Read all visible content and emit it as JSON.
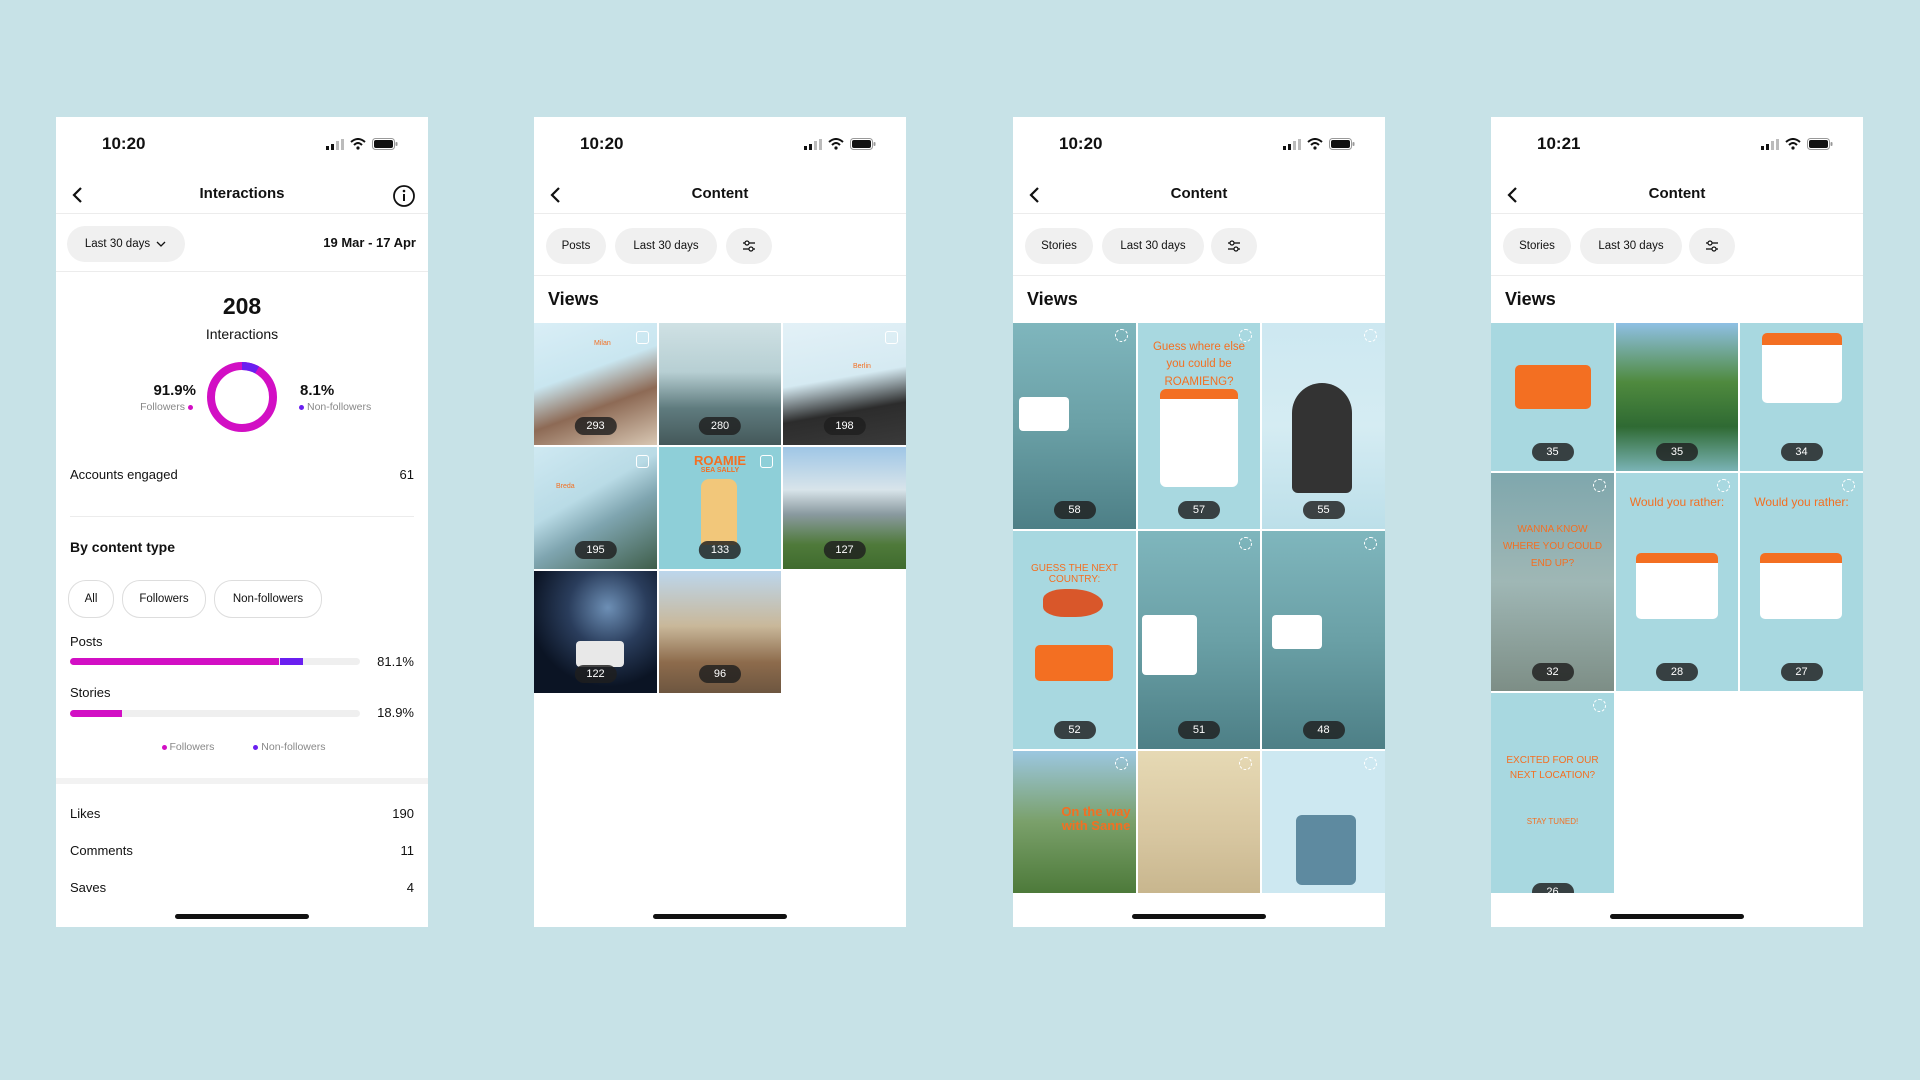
{
  "colors": {
    "magenta": "#d20fc4",
    "purple": "#6a1ff0",
    "teal": "#8ecfd8",
    "background": "#c7e2e7"
  },
  "phone1": {
    "time": "10:20",
    "title": "Interactions",
    "period": "Last 30 days",
    "date_range": "19 Mar - 17 Apr",
    "total": "208",
    "total_label": "Interactions",
    "followers_pct": "91.9%",
    "followers_label": "Followers",
    "nonfollowers_pct": "8.1%",
    "nonfollowers_label": "Non-followers",
    "donut": {
      "followers_fraction": 0.919,
      "nonfollowers_fraction": 0.081
    },
    "accounts_engaged_label": "Accounts engaged",
    "accounts_engaged": "61",
    "by_content_type": "By content type",
    "filters": [
      "All",
      "Followers",
      "Non-followers"
    ],
    "posts": {
      "label": "Posts",
      "value": "81.1%",
      "followers_fraction": 0.72,
      "nonfollowers_fraction": 0.081
    },
    "stories": {
      "label": "Stories",
      "value": "18.9%",
      "followers_fraction": 0.18,
      "nonfollowers_fraction": 0.0
    },
    "legend": [
      "Followers",
      "Non-followers"
    ],
    "metrics": [
      {
        "label": "Likes",
        "value": "190"
      },
      {
        "label": "Comments",
        "value": "11"
      },
      {
        "label": "Saves",
        "value": "4"
      }
    ]
  },
  "phone2": {
    "time": "10:20",
    "title": "Content",
    "filter1": "Posts",
    "filter2": "Last 30 days",
    "views": "Views",
    "tiles": [
      "293",
      "280",
      "198",
      "195",
      "133",
      "127",
      "122",
      "96"
    ],
    "tile_texts": [
      "Milan",
      "Berlin",
      "Breda",
      "ROAMIE",
      "SEA SALLY"
    ]
  },
  "phone3": {
    "time": "10:20",
    "title": "Content",
    "filter1": "Stories",
    "filter2": "Last 30 days",
    "views": "Views",
    "tiles": [
      "58",
      "57",
      "55",
      "52",
      "51",
      "48"
    ],
    "tile_texts": [
      "Guess where else you could be ROAMIENG?",
      "GUESS THE NEXT COUNTRY:",
      "On the way with Sanne"
    ]
  },
  "phone4": {
    "time": "10:21",
    "title": "Content",
    "filter1": "Stories",
    "filter2": "Last 30 days",
    "views": "Views",
    "tiles": [
      "35",
      "35",
      "34",
      "32",
      "28",
      "27",
      "26"
    ],
    "tile_texts": [
      "WANNA KNOW WHERE YOU COULD END UP?",
      "Would you rather:",
      "Would you rather:",
      "EXCITED FOR OUR NEXT LOCATION?",
      "STAY TUNED!"
    ]
  }
}
